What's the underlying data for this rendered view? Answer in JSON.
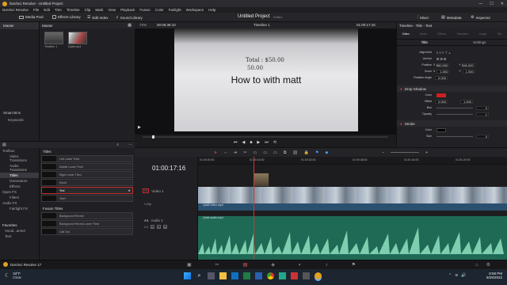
{
  "window": {
    "title": "DaVinci Resolve - Untitled Project"
  },
  "menu": [
    "DaVinci Resolve",
    "File",
    "Edit",
    "Trim",
    "Timeline",
    "Clip",
    "Mark",
    "View",
    "Playback",
    "Fusion",
    "Color",
    "Fairlight",
    "Workspace",
    "Help"
  ],
  "toolbar": {
    "media_pool": "Media Pool",
    "effects_library": "Effects Library",
    "edit_index": "Edit Index",
    "sound_library": "Sound Library",
    "project_title": "Untitled Project",
    "project_status": "Edited",
    "mixer": "Mixer",
    "metadata": "Metadata",
    "inspector": "Inspector"
  },
  "media_pool": {
    "master_label": "Master",
    "bin_header": "Master",
    "clips": [
      "Timeline 1",
      "Quiet.mp4"
    ],
    "smart_bins_label": "Smart Bins",
    "keywords_label": "Keywords"
  },
  "viewer": {
    "zoom": "72%",
    "source_timecode": "00:06:38:10",
    "timeline_name": "Timeline 1",
    "record_timecode": "01:00:17:16",
    "paper_line1": "Total : $50.00",
    "paper_line2": "50.00",
    "overlay_title": "How to with matt"
  },
  "inspector": {
    "header": "Timeline - Title - Text",
    "tabs": [
      "Video",
      "Audio",
      "Effects",
      "Transition",
      "Image",
      "File"
    ],
    "subtabs": [
      "Title",
      "Settings"
    ],
    "rows": [
      {
        "label": "Alignment",
        "value": ""
      },
      {
        "label": "Anchor",
        "value": ""
      },
      {
        "label": "Position",
        "x_label": "X",
        "x": "960.000",
        "y_label": "Y",
        "y": "540.000"
      },
      {
        "label": "Zoom",
        "x_label": "X",
        "x": "1.000",
        "y_label": "Y",
        "y": "1.000"
      },
      {
        "label": "Rotation Angle",
        "x": "0.000"
      }
    ],
    "drop_shadow": {
      "title": "Drop Shadow",
      "color_label": "Color",
      "color": "#cc2020",
      "offset_label": "Offset",
      "offset_x": "0.000",
      "offset_y": "1.000",
      "blur_label": "Blur",
      "blur": "0",
      "opacity_label": "Opacity",
      "opacity": "1"
    },
    "stroke": {
      "title": "Stroke",
      "color_label": "Color",
      "size_label": "Size",
      "size": "0"
    }
  },
  "effects": {
    "tree": [
      "Toolbox",
      "Video Transitions",
      "Audio Transitions",
      "Titles",
      "Generators",
      "Effects",
      "Open FX",
      "Filters",
      "Audio FX",
      "Fairlight FX"
    ],
    "favorites_label": "Favorites",
    "favorites": [
      "Vocal...annel",
      "Text"
    ],
    "titles_header": "Titles",
    "titles": [
      "Left Lower Third",
      "Middle Lower Third",
      "Right Lower Third",
      "Scroll",
      "Text",
      "Text+"
    ],
    "fusion_header": "Fusion Titles",
    "fusion_titles": [
      "Background Reveal",
      "Background Reveal Lower Third",
      "Call Out"
    ]
  },
  "timeline": {
    "timecode": "01:00:17:16",
    "ruler": [
      "01:00:00:00",
      "01:00:16:00",
      "01:00:32:00",
      "01:00:48:00",
      "01:01:04:00",
      "01:01:20:00"
    ],
    "v1_label": "Video 1",
    "v1_id": "V1",
    "a1_id": "A1",
    "a1_label": "Audio 1",
    "a1_channel": "2.0",
    "video_clip_name": "Quiet-video.mp4",
    "audio_clip_name": "Quiet-audio.mp4",
    "v1_clip_count": "1 Clip"
  },
  "status": {
    "app_name": "DaVinci Resolve 17"
  },
  "taskbar": {
    "weather_temp": "34°F",
    "weather_text": "Clear",
    "time": "8:58 PM",
    "date": "6/29/2022"
  }
}
